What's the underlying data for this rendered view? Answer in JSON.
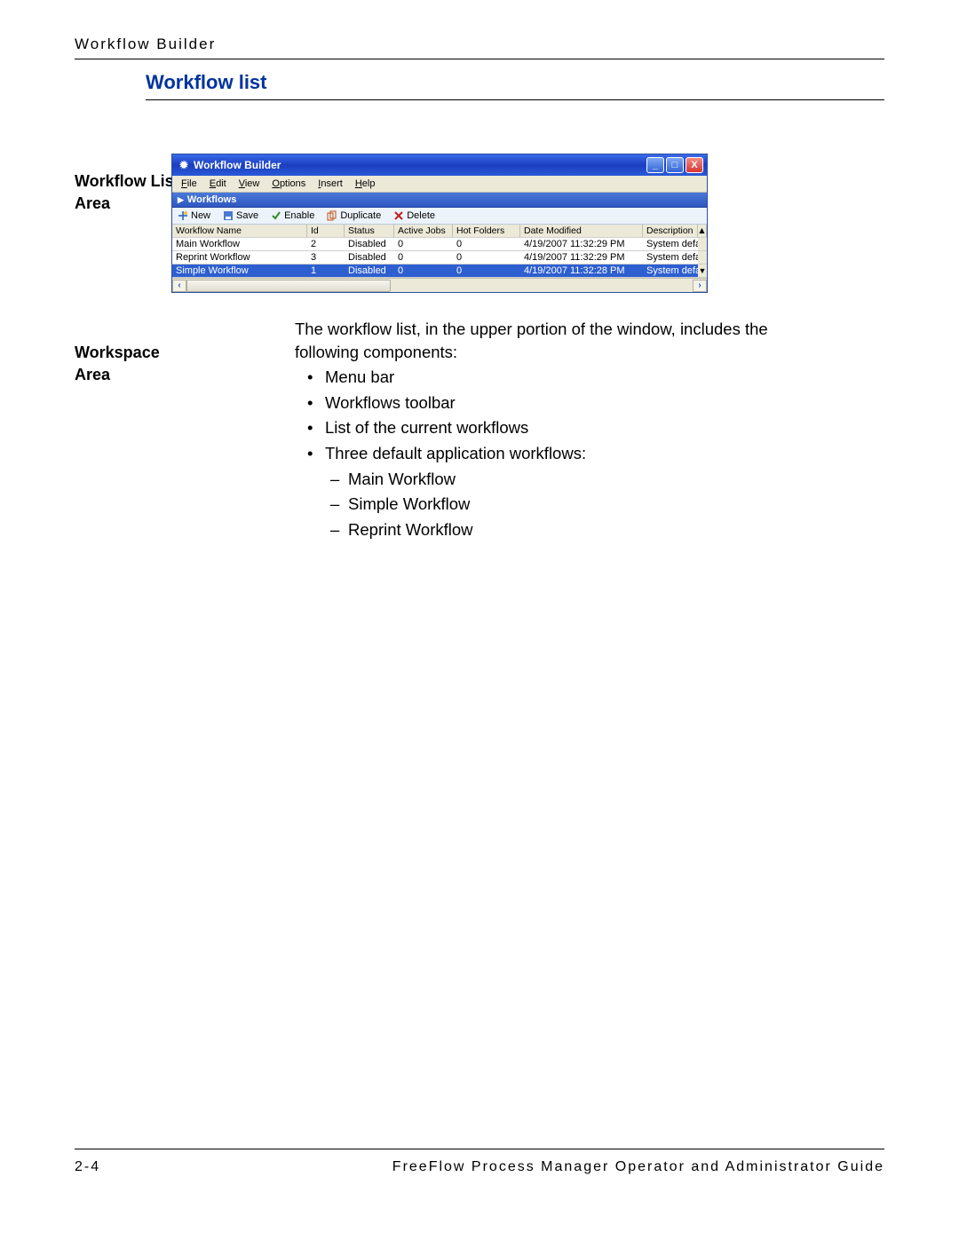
{
  "header": "Workflow Builder",
  "section_title": "Workflow list",
  "margin_label_1": "Workflow List\nArea",
  "margin_label_2": "Workspace\nArea",
  "window": {
    "title": "Workflow Builder",
    "menu": [
      "File",
      "Edit",
      "View",
      "Options",
      "Insert",
      "Help"
    ],
    "panel_title": "Workflows",
    "toolbar": [
      "New",
      "Save",
      "Enable",
      "Duplicate",
      "Delete"
    ],
    "columns": [
      "Workflow Name",
      "Id",
      "Status",
      "Active Jobs",
      "Hot Folders",
      "Date Modified",
      "Description"
    ],
    "rows": [
      {
        "name": "Main Workflow",
        "id": "2",
        "status": "Disabled",
        "active": "0",
        "hot": "0",
        "date": "4/19/2007 11:32:29 PM",
        "desc": "System default workflo"
      },
      {
        "name": "Reprint Workflow",
        "id": "3",
        "status": "Disabled",
        "active": "0",
        "hot": "0",
        "date": "4/19/2007 11:32:29 PM",
        "desc": "System default workflo"
      },
      {
        "name": "Simple Workflow",
        "id": "1",
        "status": "Disabled",
        "active": "0",
        "hot": "0",
        "date": "4/19/2007 11:32:28 PM",
        "desc": "System default workflo"
      }
    ]
  },
  "paragraph": "The workflow list, in the upper portion of the window, includes the following components:",
  "bullets": [
    "Menu bar",
    "Workflows toolbar",
    "List of the current workflows",
    "Three default application workflows:"
  ],
  "sub_bullets": [
    "Main Workflow",
    "Simple Workflow",
    "Reprint Workflow"
  ],
  "footer": {
    "left": "2-4",
    "right": "FreeFlow Process Manager Operator and Administrator Guide"
  }
}
